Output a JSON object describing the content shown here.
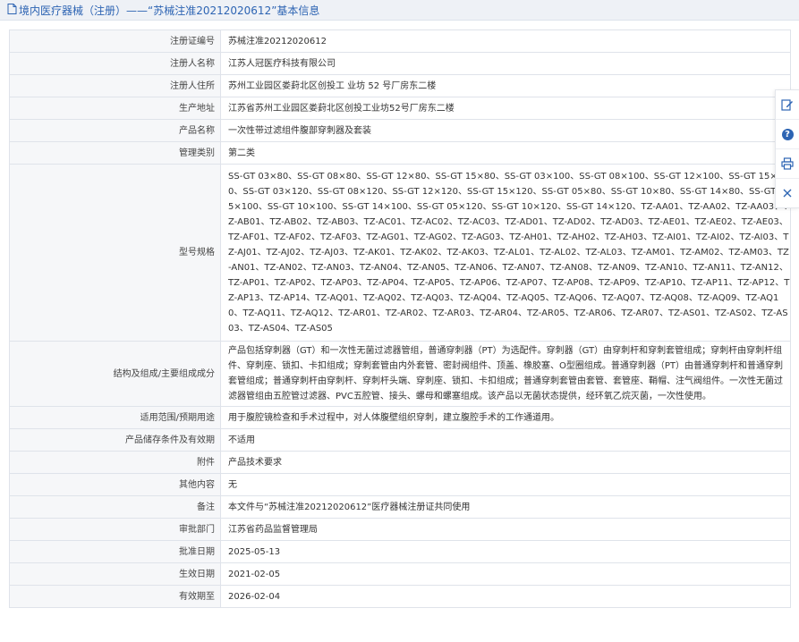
{
  "header": {
    "title": "境内医疗器械（注册）——“苏械注准20212020612”基本信息"
  },
  "rows": [
    {
      "label": "注册证编号",
      "value": "苏械注准20212020612"
    },
    {
      "label": "注册人名称",
      "value": "江苏人冠医疗科技有限公司"
    },
    {
      "label": "注册人住所",
      "value": "苏州工业园区娄葑北区创投工 业坊 52 号厂房东二楼"
    },
    {
      "label": "生产地址",
      "value": "江苏省苏州工业园区娄葑北区创投工业坊52号厂房东二楼"
    },
    {
      "label": "产品名称",
      "value": "一次性带过滤组件腹部穿刺器及套装"
    },
    {
      "label": "管理类别",
      "value": "第二类"
    },
    {
      "label": "型号规格",
      "value": "SS-GT 03×80、SS-GT 08×80、SS-GT 12×80、SS-GT 15×80、SS-GT 03×100、SS-GT 08×100、SS-GT 12×100、SS-GT 15×100、SS-GT 03×120、SS-GT 08×120、SS-GT 12×120、SS-GT 15×120、SS-GT 05×80、SS-GT 10×80、SS-GT 14×80、SS-GT 05×100、SS-GT 10×100、SS-GT 14×100、SS-GT 05×120、SS-GT 10×120、SS-GT 14×120、TZ-AA01、TZ-AA02、TZ-AA03、TZ-AB01、TZ-AB02、TZ-AB03、TZ-AC01、TZ-AC02、TZ-AC03、TZ-AD01、TZ-AD02、TZ-AD03、TZ-AE01、TZ-AE02、TZ-AE03、TZ-AF01、TZ-AF02、TZ-AF03、TZ-AG01、TZ-AG02、TZ-AG03、TZ-AH01、TZ-AH02、TZ-AH03、TZ-AI01、TZ-AI02、TZ-AI03、TZ-AJ01、TZ-AJ02、TZ-AJ03、TZ-AK01、TZ-AK02、TZ-AK03、TZ-AL01、TZ-AL02、TZ-AL03、TZ-AM01、TZ-AM02、TZ-AM03、TZ-AN01、TZ-AN02、TZ-AN03、TZ-AN04、TZ-AN05、TZ-AN06、TZ-AN07、TZ-AN08、TZ-AN09、TZ-AN10、TZ-AN11、TZ-AN12、TZ-AP01、TZ-AP02、TZ-AP03、TZ-AP04、TZ-AP05、TZ-AP06、TZ-AP07、TZ-AP08、TZ-AP09、TZ-AP10、TZ-AP11、TZ-AP12、TZ-AP13、TZ-AP14、TZ-AQ01、TZ-AQ02、TZ-AQ03、TZ-AQ04、TZ-AQ05、TZ-AQ06、TZ-AQ07、TZ-AQ08、TZ-AQ09、TZ-AQ10、TZ-AQ11、TZ-AQ12、TZ-AR01、TZ-AR02、TZ-AR03、TZ-AR04、TZ-AR05、TZ-AR06、TZ-AR07、TZ-AS01、TZ-AS02、TZ-AS03、TZ-AS04、TZ-AS05"
    },
    {
      "label": "结构及组成/主要组成成分",
      "value": "产品包括穿刺器（GT）和一次性无菌过滤器管组，普通穿刺器（PT）为选配件。穿刺器（GT）由穿刺杆和穿刺套管组成；穿刺杆由穿刺杆组件、穿刺座、锁扣、卡扣组成；穿刺套管由内外套管、密封阀组件、顶盖、橡胶塞、O型圈组成。普通穿刺器（PT）由普通穿刺杆和普通穿刺套管组成；普通穿刺杆由穿刺杆、穿刺杆头端、穿刺座、锁扣、卡扣组成；普通穿刺套管由套管、套管座、鞘帽、注气阀组件。一次性无菌过滤器管组由五腔管过滤器、PVC五腔管、接头、螺母和螺塞组成。该产品以无菌状态提供，经环氧乙烷灭菌，一次性使用。"
    },
    {
      "label": "适用范围/预期用途",
      "value": "用于腹腔镜检查和手术过程中，对人体腹壁组织穿刺，建立腹腔手术的工作通道用。"
    },
    {
      "label": "产品储存条件及有效期",
      "value": "不适用"
    },
    {
      "label": "附件",
      "value": "产品技术要求"
    },
    {
      "label": "其他内容",
      "value": "无"
    },
    {
      "label": "备注",
      "value": "本文件与“苏械注准20212020612”医疗器械注册证共同使用"
    },
    {
      "label": "审批部门",
      "value": "江苏省药品监督管理局"
    },
    {
      "label": "批准日期",
      "value": "2025-05-13"
    },
    {
      "label": "生效日期",
      "value": "2021-02-05"
    },
    {
      "label": "有效期至",
      "value": "2026-02-04"
    }
  ],
  "floating_toolbar": {
    "items": [
      {
        "icon": "edit-icon",
        "label": "意"
      },
      {
        "icon": "help-icon",
        "label": "?"
      },
      {
        "icon": "print-icon",
        "label": "打"
      },
      {
        "icon": "close-icon",
        "label": "关"
      }
    ]
  },
  "colors": {
    "accent": "#2d64b3",
    "header_bg": "#eef1f6",
    "label_bg": "#f6f7f9",
    "border": "#dfe3ea"
  }
}
